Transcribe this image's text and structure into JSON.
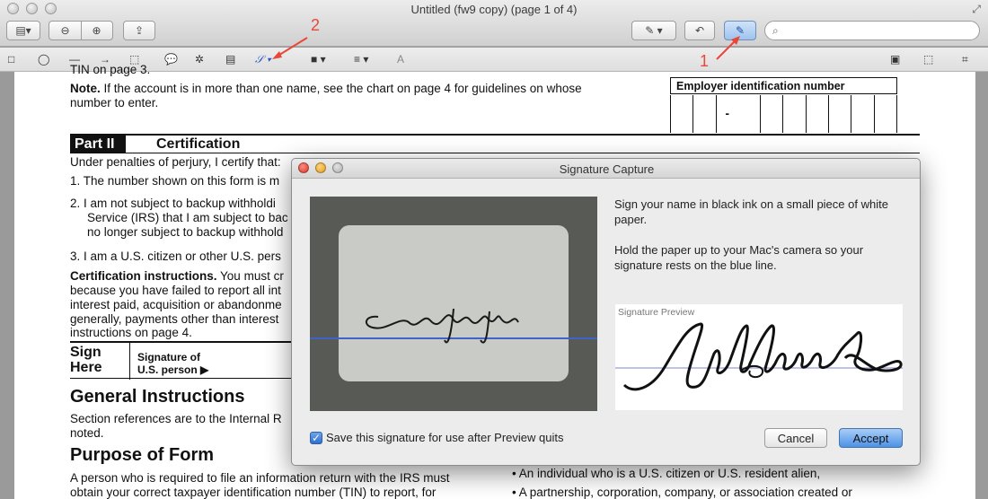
{
  "window": {
    "title": "Untitled (fw9 copy) (page 1 of 4)"
  },
  "toolbar": {
    "search_placeholder": ""
  },
  "annotations": {
    "marker_1": "1",
    "marker_2": "2",
    "color": "#e8483a"
  },
  "document": {
    "top_fragment": "TIN on page 3.",
    "note_label": "Note.",
    "note_text": " If the account is in more than one name, see the chart on page 4 for guidelines on whose",
    "note_text2": "number to enter.",
    "ein_label": "Employer identification number",
    "ein_dash": "-",
    "part_tag": "Part II",
    "part_title": "Certification",
    "under_penalties": "Under penalties of perjury, I certify that:",
    "item1": "1.  The number shown on this form is m",
    "item2a": "2.  I am not subject to backup withholdi",
    "item2b": "Service (IRS) that I am subject to bac",
    "item2c": "no longer subject to backup withhold",
    "item3": "3.  I am a U.S. citizen or other U.S. pers",
    "cert_label": "Certification instructions.",
    "cert_text": " You must cr",
    "cert_l2": "because you have failed to report all int",
    "cert_l3": "interest paid, acquisition or abandonme",
    "cert_l4": "generally, payments other than interest",
    "cert_l5": "instructions on page 4.",
    "sign_label_1": "Sign",
    "sign_label_2": "Here",
    "sig_of_1": "Signature of",
    "sig_of_2": "U.S. person ▶",
    "gen_instr": "General Instructions",
    "gen_l1": "Section references are to the Internal R",
    "gen_l2": "noted.",
    "purpose": "Purpose of Form",
    "purpose_l1": "A person who is required to file an information return with the IRS must",
    "purpose_l2": "obtain your correct taxpayer identification number (TIN) to report, for",
    "bullet1": "• An individual who is a U.S. citizen or U.S. resident alien,",
    "bullet2": "• A partnership, corporation, company, or association created or"
  },
  "dialog": {
    "title": "Signature Capture",
    "instr1": "Sign your name in black ink on a small piece of white paper.",
    "instr2": "Hold the paper up to your Mac's camera so your signature rests on the blue line.",
    "preview_label": "Signature Preview",
    "save_checkbox_label": "Save this signature for use after Preview quits",
    "save_checked": true,
    "cancel_label": "Cancel",
    "accept_label": "Accept"
  }
}
